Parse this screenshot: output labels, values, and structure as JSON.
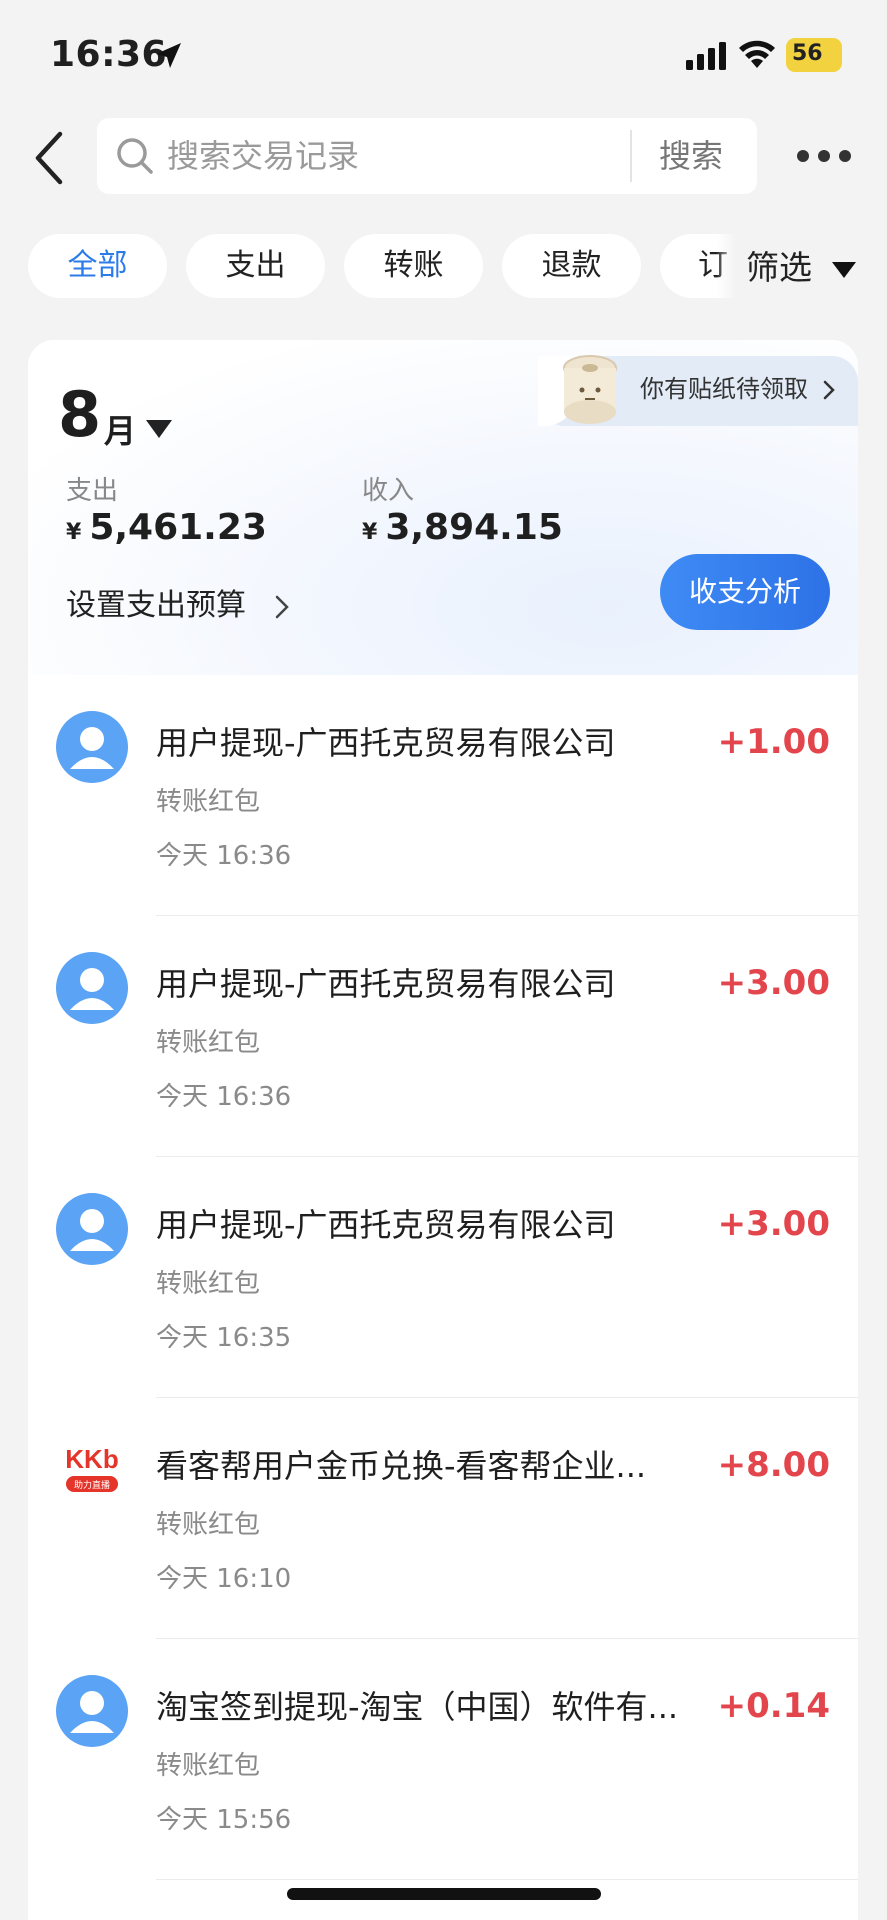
{
  "status_bar": {
    "time": "16:36",
    "battery": "56",
    "battery_color": "#f2d23e"
  },
  "search": {
    "placeholder": "搜索交易记录",
    "button": "搜索"
  },
  "tabs": [
    {
      "label": "全部",
      "active": true
    },
    {
      "label": "支出",
      "active": false
    },
    {
      "label": "转账",
      "active": false
    },
    {
      "label": "退款",
      "active": false
    },
    {
      "label": "订",
      "active": false
    }
  ],
  "filter": {
    "label": "筛选"
  },
  "summary": {
    "month": "8",
    "month_unit": "月",
    "sticker_text": "你有贴纸待领取",
    "expense_label": "支出",
    "expense_currency": "¥",
    "expense_value": "5,461.23",
    "income_label": "收入",
    "income_currency": "¥",
    "income_value": "3,894.15",
    "budget_label": "设置支出预算",
    "analysis_button": "收支分析"
  },
  "transactions": [
    {
      "title": "用户提现-广西托克贸易有限公司",
      "amount": "+1.00",
      "type": "转账红包",
      "time": "今天 16:36",
      "avatar": "person-icon"
    },
    {
      "title": "用户提现-广西托克贸易有限公司",
      "amount": "+3.00",
      "type": "转账红包",
      "time": "今天 16:36",
      "avatar": "person-icon"
    },
    {
      "title": "用户提现-广西托克贸易有限公司",
      "amount": "+3.00",
      "type": "转账红包",
      "time": "今天 16:35",
      "avatar": "person-icon"
    },
    {
      "title": "看客帮用户金币兑换-看客帮企业...",
      "amount": "+8.00",
      "type": "转账红包",
      "time": "今天 16:10",
      "avatar": "kkb-logo-icon",
      "logo_text": "KKb",
      "logo_subtext": "助力直播"
    },
    {
      "title": "淘宝签到提现-淘宝（中国）软件有...",
      "amount": "+0.14",
      "type": "转账红包",
      "time": "今天 15:56",
      "avatar": "person-icon"
    }
  ],
  "colors": {
    "accent": "#2b7be9",
    "income_amount": "#e2454b",
    "avatar_blue": "#5aa3f5",
    "kkb_red": "#e5352b"
  }
}
